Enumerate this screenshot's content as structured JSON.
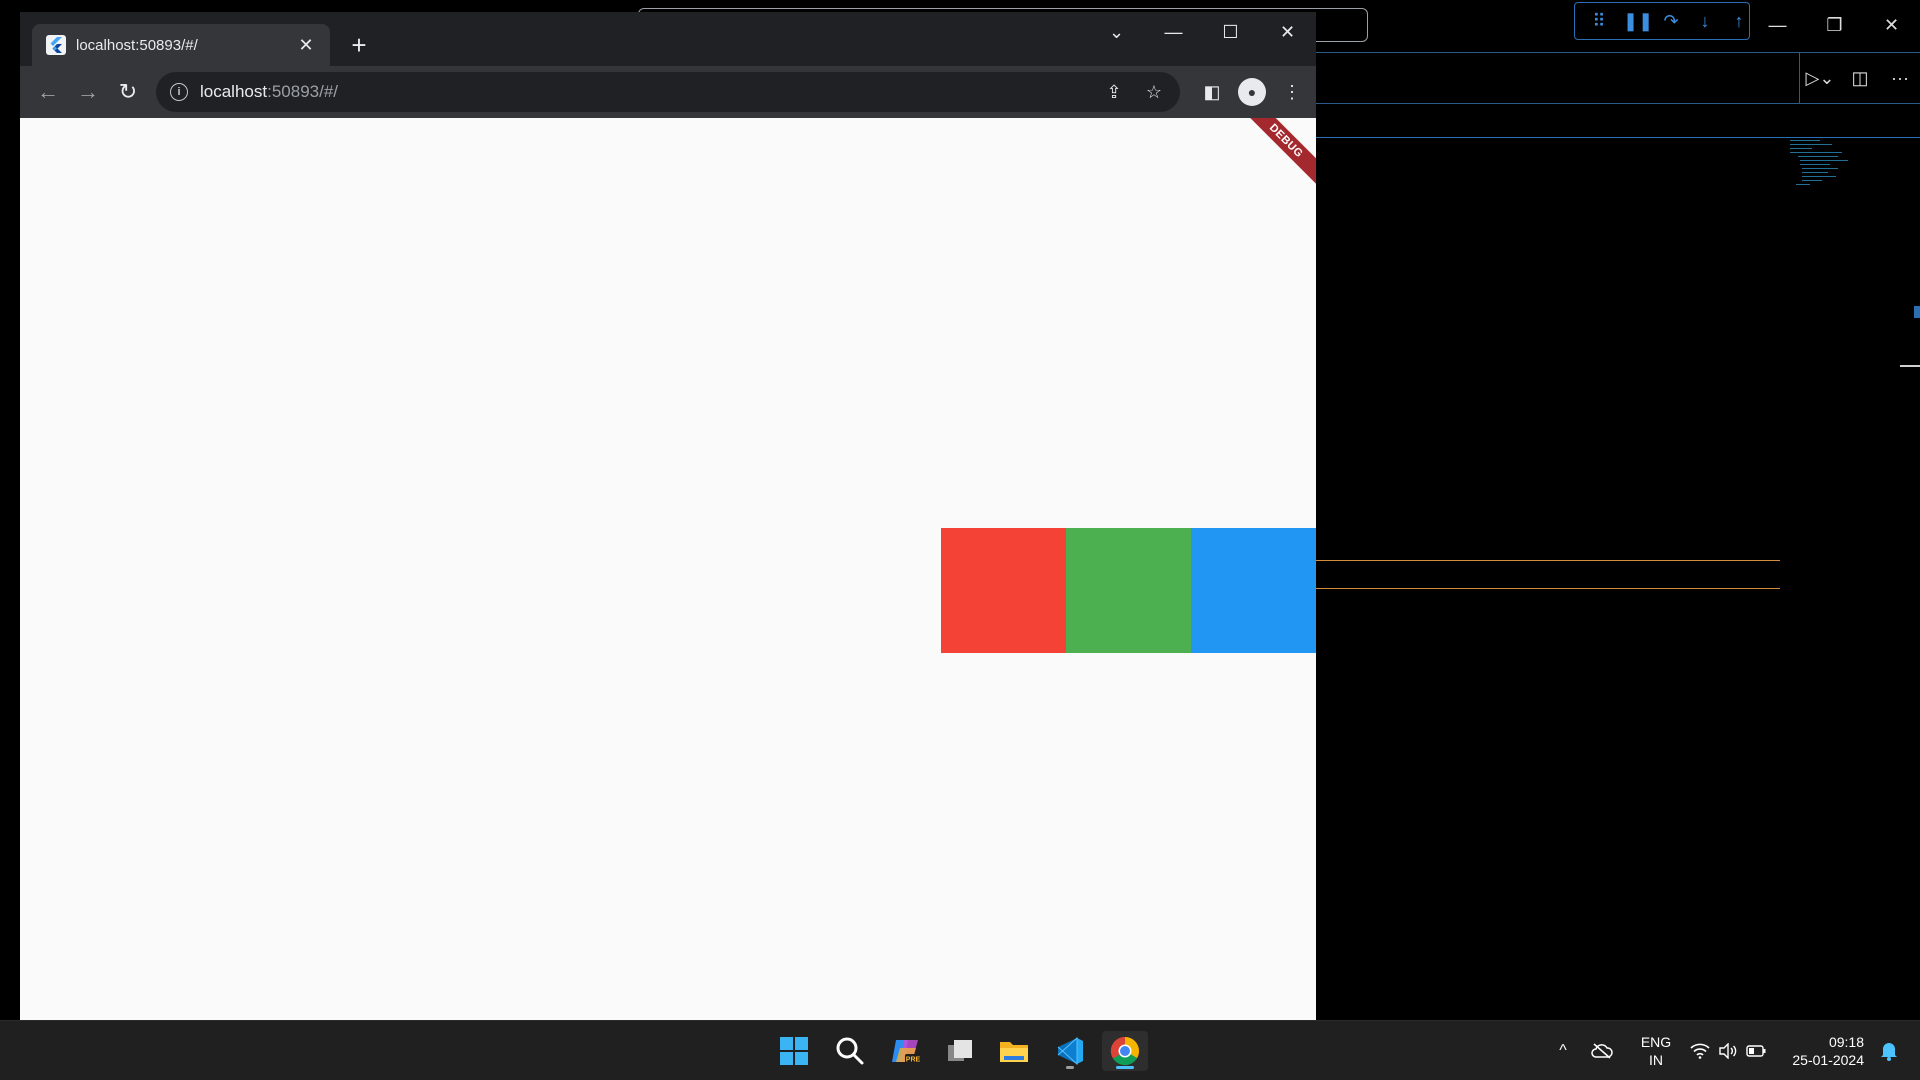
{
  "vscode": {
    "debug_toolbar": [
      "⠿",
      "❚❚",
      "↷",
      "↓",
      "↑"
    ],
    "window_controls": [
      "—",
      "❐",
      "✕"
    ],
    "tab_actions": [
      "▷⌄",
      "◫",
      "···"
    ]
  },
  "chrome": {
    "tab": {
      "title": "localhost:50893/#/",
      "favicon": "flutter-icon",
      "close": "✕"
    },
    "new_tab": "+",
    "window_controls": [
      "⌄",
      "—",
      "☐",
      "✕"
    ],
    "nav": {
      "back": "←",
      "forward": "→",
      "reload": "↻"
    },
    "omnibox": {
      "host": "localhost",
      "path": ":50893/#/",
      "info": "i"
    },
    "omnibox_actions": [
      "⇪",
      "☆"
    ],
    "toolbar_right": [
      "◧",
      "●",
      "⋮"
    ]
  },
  "app": {
    "debug_banner": "DEBUG",
    "boxes": [
      {
        "name": "red-box",
        "color": "#f44336"
      },
      {
        "name": "green-box",
        "color": "#4caf50"
      },
      {
        "name": "blue-box",
        "color": "#2196f3"
      }
    ]
  },
  "taskbar": {
    "apps": [
      "start-icon",
      "search-icon",
      "copilot-icon",
      "task-view-icon",
      "file-explorer-icon",
      "vscode-icon",
      "chrome-icon"
    ],
    "tray": {
      "chevron": "^",
      "cloud": "☁",
      "lang_line1": "ENG",
      "lang_line2": "IN",
      "time": "09:18",
      "date": "25-01-2024"
    }
  }
}
